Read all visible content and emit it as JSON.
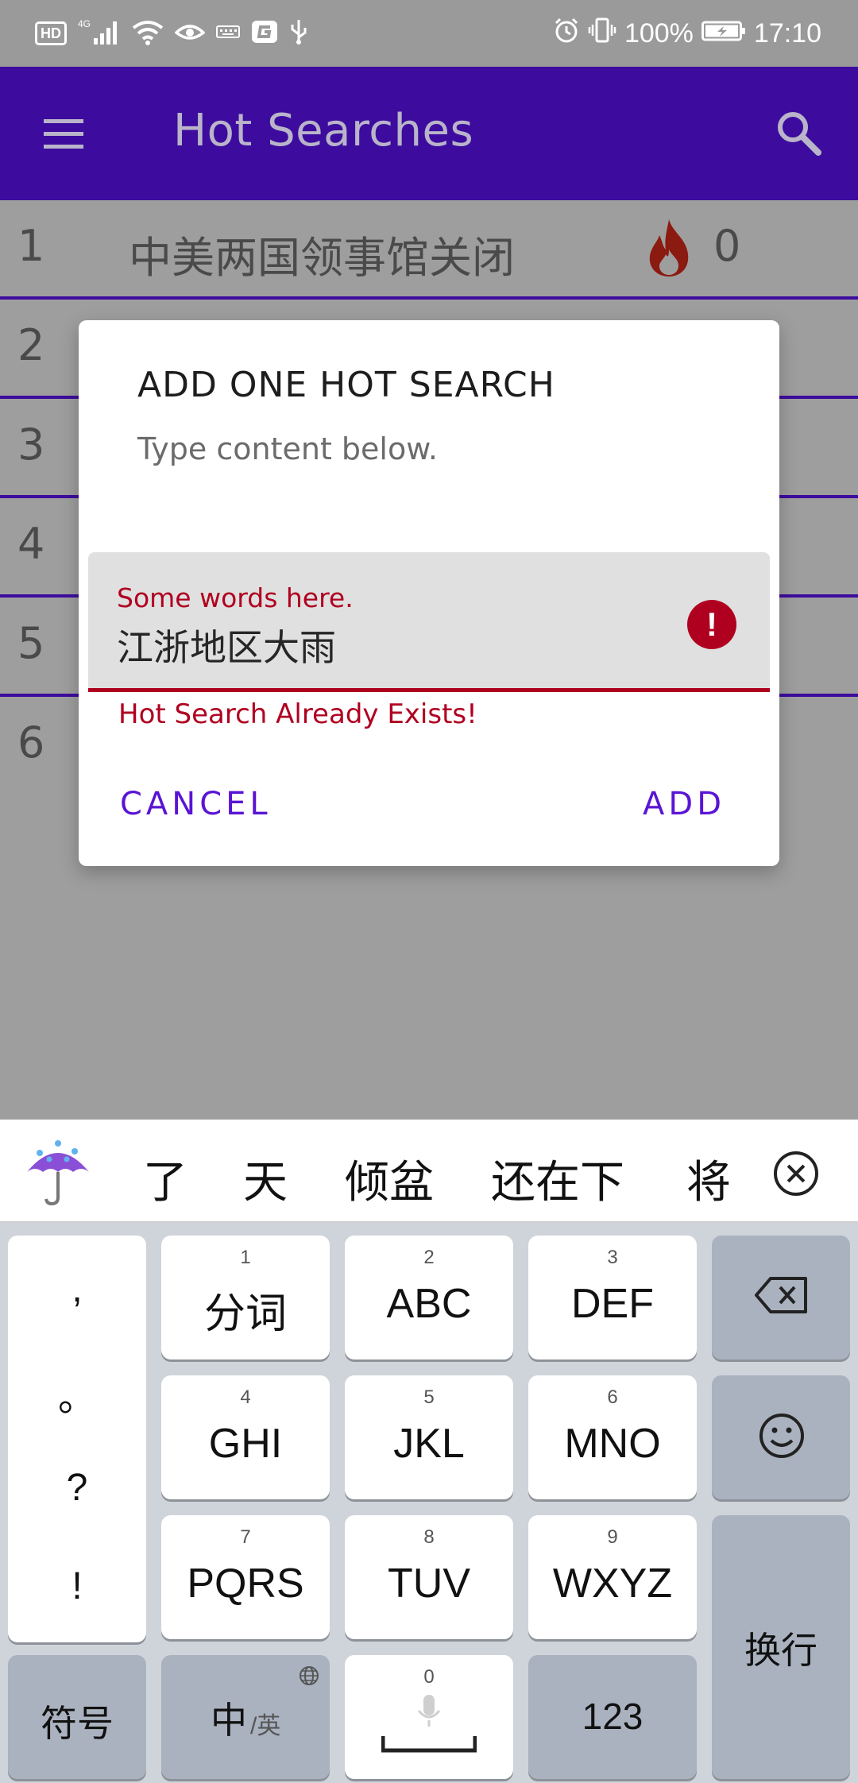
{
  "status_bar": {
    "hd_badge": "HD",
    "network": "4G",
    "battery": "100%",
    "time": "17:10"
  },
  "app_bar": {
    "title": "Hot Searches"
  },
  "list": [
    {
      "rank": "1",
      "text": "中美两国领事馆关闭",
      "count": "0"
    },
    {
      "rank": "2"
    },
    {
      "rank": "3"
    },
    {
      "rank": "4"
    },
    {
      "rank": "5"
    },
    {
      "rank": "6"
    }
  ],
  "dialog": {
    "title": "ADD ONE HOT SEARCH",
    "subtitle": "Type content below.",
    "field_label": "Some words here.",
    "field_value": "江浙地区大雨",
    "error_icon": "!",
    "error_text": "Hot Search Already Exists!",
    "cancel": "CANCEL",
    "add": "ADD"
  },
  "suggestions": {
    "emoji": "umbrella-rain-emoji",
    "words": [
      "了",
      "天",
      "倾盆",
      "还在下",
      "将"
    ]
  },
  "keyboard": {
    "punctuation": [
      ",",
      "。",
      "?",
      "!"
    ],
    "keys": [
      {
        "num": "1",
        "label": "分词"
      },
      {
        "num": "2",
        "label": "ABC"
      },
      {
        "num": "3",
        "label": "DEF"
      },
      {
        "num": "4",
        "label": "GHI"
      },
      {
        "num": "5",
        "label": "JKL"
      },
      {
        "num": "6",
        "label": "MNO"
      },
      {
        "num": "7",
        "label": "PQRS"
      },
      {
        "num": "8",
        "label": "TUV"
      },
      {
        "num": "9",
        "label": "WXYZ"
      }
    ],
    "symbols": "符号",
    "lang_main": "中",
    "lang_sub": "/英",
    "space_num": "0",
    "numbers": "123",
    "enter": "换行"
  },
  "colors": {
    "app_bar": "#3d0c9e",
    "accent": "#5a14d4",
    "error": "#b00020",
    "scrim": "#9e9e9e"
  }
}
